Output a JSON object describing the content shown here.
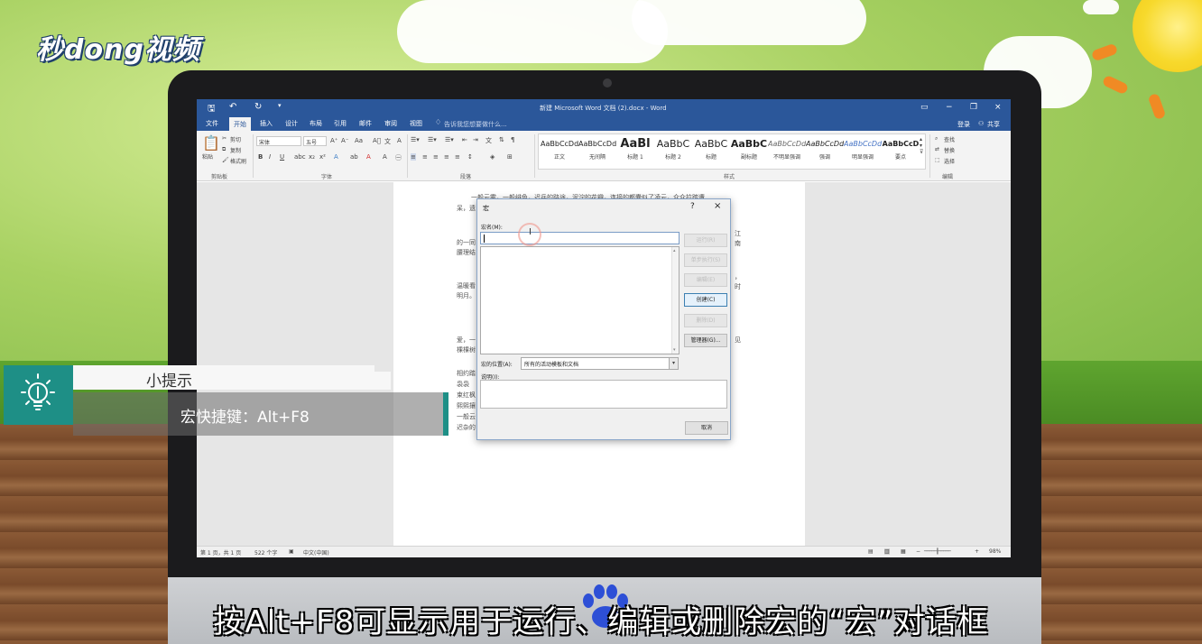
{
  "logo": {
    "text": "秒dong视频"
  },
  "word": {
    "title": "新建 Microsoft Word 文档 (2).docx - Word",
    "menus": [
      "文件",
      "开始",
      "插入",
      "设计",
      "布局",
      "引用",
      "邮件",
      "审阅",
      "视图"
    ],
    "active_menu_index": 1,
    "tell_me": "告诉我您想要做什么...",
    "login": "登录",
    "share": "共享",
    "ribbon": {
      "clipboard": {
        "paste": "粘贴",
        "cut": "剪切",
        "copy": "复制",
        "format_painter": "格式刷",
        "label": "剪贴板"
      },
      "font": {
        "name": "宋体",
        "size": "五号",
        "label": "字体"
      },
      "paragraph": {
        "label": "段落"
      },
      "styles": {
        "label": "样式",
        "items": [
          {
            "sample": "AaBbCcDd",
            "name": "正文"
          },
          {
            "sample": "AaBbCcDd",
            "name": "无间隔"
          },
          {
            "sample": "AaBl",
            "name": "标题 1"
          },
          {
            "sample": "AaBbC",
            "name": "标题 2"
          },
          {
            "sample": "AaBbC",
            "name": "标题"
          },
          {
            "sample": "AaBbC",
            "name": "副标题"
          },
          {
            "sample": "AaBbCcDd",
            "name": "不明显强调"
          },
          {
            "sample": "AaBbCcDd",
            "name": "强调"
          },
          {
            "sample": "AaBbCcDd",
            "name": "明显强调"
          },
          {
            "sample": "AaBbCcD",
            "name": "要点"
          }
        ]
      },
      "editing": {
        "find": "查找",
        "replace": "替换",
        "select": "选择",
        "label": "编辑"
      }
    },
    "doc_lines": [
      "一般云雾，一般绯色，迟兵的路途，泥泞的花瓣，连接的都囊似了凌云，众众拉踏遭",
      "呆，遗",
      "的一同",
      "腰理结",
      "温暖看",
      "明月。",
      "爱，一",
      "棵棵树",
      "相约踏",
      "袅袅",
      "束红枫",
      "熙熙攘",
      "一般云",
      "迟杂的"
    ],
    "doc_right": [
      "江",
      "南",
      "，",
      "时",
      "见"
    ],
    "status": {
      "page": "第 1 页，共 1 页",
      "words": "522 个字",
      "lang": "中文(中国)",
      "zoom": "98%"
    }
  },
  "dialog": {
    "title": "宏",
    "help": "?",
    "close": "×",
    "macro_name_label": "宏名(M):",
    "macro_name_value": "",
    "buttons": {
      "run": "运行(R)",
      "step_into": "单步执行(S)",
      "edit": "编辑(E)",
      "create": "创建(C)",
      "delete": "删除(D)",
      "organizer": "管理器(G)...",
      "cancel": "取消"
    },
    "location_label": "宏的位置(A):",
    "location_value": "所有的活动模板和文档",
    "description_label": "说明(I):"
  },
  "tip": {
    "title": "小提示",
    "text": "宏快捷键：Alt+F8"
  },
  "caption": "按Alt+F8可显示用于运行、编辑或删除宏的“宏”对话框",
  "colors": {
    "word_blue": "#2b579a",
    "tip_teal": "#1e8f86"
  }
}
